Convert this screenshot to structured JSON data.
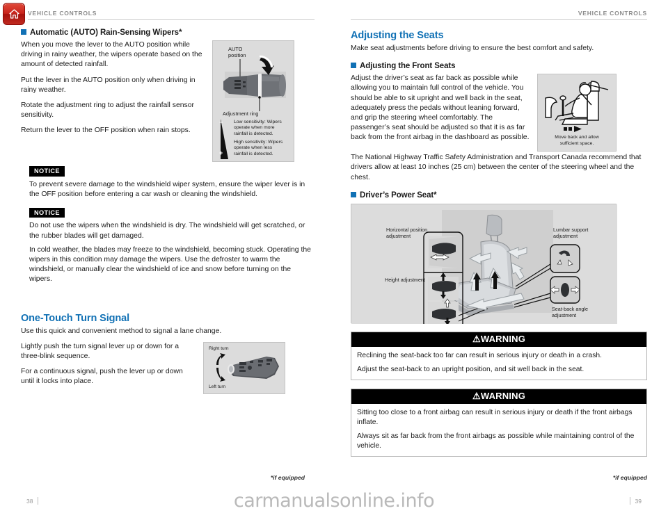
{
  "home_button": {
    "icon": "home-icon",
    "color": "#c9231b"
  },
  "accent_color": "#1171b5",
  "left_page": {
    "running_header": "VEHICLE CONTROLS",
    "section_heading": "Automatic (AUTO) Rain-Sensing Wipers*",
    "paragraphs": [
      "When you move the lever to the AUTO position while driving in rainy weather, the wipers operate based on the amount of detected rainfall.",
      "Put the lever in the AUTO position only when driving in rainy weather.",
      "Rotate the adjustment ring to adjust the rainfall sensor sensitivity.",
      "Return the lever to the OFF position when rain stops."
    ],
    "wiper_figure": {
      "label_auto": "AUTO\nposition",
      "label_auto_line1": "AUTO",
      "label_auto_line2": "position",
      "label_ring": "Adjustment ring",
      "minus_sign": "−",
      "plus_sign": "+",
      "caption_low": "Low sensitivity: Wipers operate when more rainfall is detected.",
      "caption_high": "High sensitivity: Wipers operate when less rainfall is detected."
    },
    "notices": [
      {
        "tag": "NOTICE",
        "paragraphs": [
          "To prevent severe damage to the windshield wiper system, ensure the wiper lever is in the OFF position before entering a car wash or cleaning the windshield."
        ]
      },
      {
        "tag": "NOTICE",
        "paragraphs": [
          "Do not use the wipers when the windshield is dry. The windshield will get scratched, or the rubber blades will get damaged.",
          "In cold weather, the blades may freeze to the windshield, becoming stuck. Operating the wipers in this condition may damage the wipers. Use the defroster to warm the windshield, or manually clear the windshield of ice and snow before turning on the wipers."
        ]
      }
    ],
    "turn_signal": {
      "heading": "One-Touch Turn Signal",
      "intro": "Use this quick and convenient method to signal a lane change.",
      "paragraphs": [
        "Lightly push the turn signal lever up or down for a three-blink sequence.",
        "For a continuous signal, push the lever up or down until it locks into place."
      ],
      "figure": {
        "label_right": "Right turn",
        "label_left": "Left turn"
      }
    },
    "if_equipped": "*if equipped",
    "page_number": "38"
  },
  "right_page": {
    "running_header": "VEHICLE CONTROLS",
    "section_heading": "Adjusting the Seats",
    "section_intro": "Make seat adjustments before driving to ensure the best comfort and safety.",
    "front_seats": {
      "heading": "Adjusting the Front Seats",
      "paragraphs": [
        "Adjust the driver’s seat as far back as possible while allowing you to maintain full control of the vehicle. You should be able to sit upright and well back in the seat, adequately press the pedals without leaning forward, and grip the steering wheel comfortably. The passenger’s seat should be adjusted so that it is as far back from the front airbag in the dashboard as possible.",
        "The National Highway Traffic Safety Administration and Transport Canada recommend that drivers allow at least 10 inches (25 cm) between the center of the steering wheel and the chest."
      ],
      "figure_caption_line1": "Move back and allow",
      "figure_caption_line2": "sufficient space."
    },
    "power_seat": {
      "heading": "Driver’s Power Seat*",
      "labels": {
        "horizontal_line1": "Horizontal position",
        "horizontal_line2": "adjustment",
        "height": "Height adjustment",
        "lumbar_line1": "Lumbar support",
        "lumbar_line2": "adjustment",
        "seatback_line1": "Seat-back angle",
        "seatback_line2": "adjustment"
      }
    },
    "warnings": [
      {
        "title": "WARNING",
        "paragraphs": [
          "Reclining the seat-back too far can result in serious injury or death in a crash.",
          "Adjust the seat-back to an upright position, and sit well back in the seat."
        ]
      },
      {
        "title": "WARNING",
        "paragraphs": [
          "Sitting too close to a front airbag can result in serious injury or death if the front airbags inflate.",
          "Always sit as far back from the front airbags as possible while maintaining control of the vehicle."
        ]
      }
    ],
    "if_equipped": "*if equipped",
    "page_number": "39"
  },
  "watermark": "carmanualsonline.info"
}
